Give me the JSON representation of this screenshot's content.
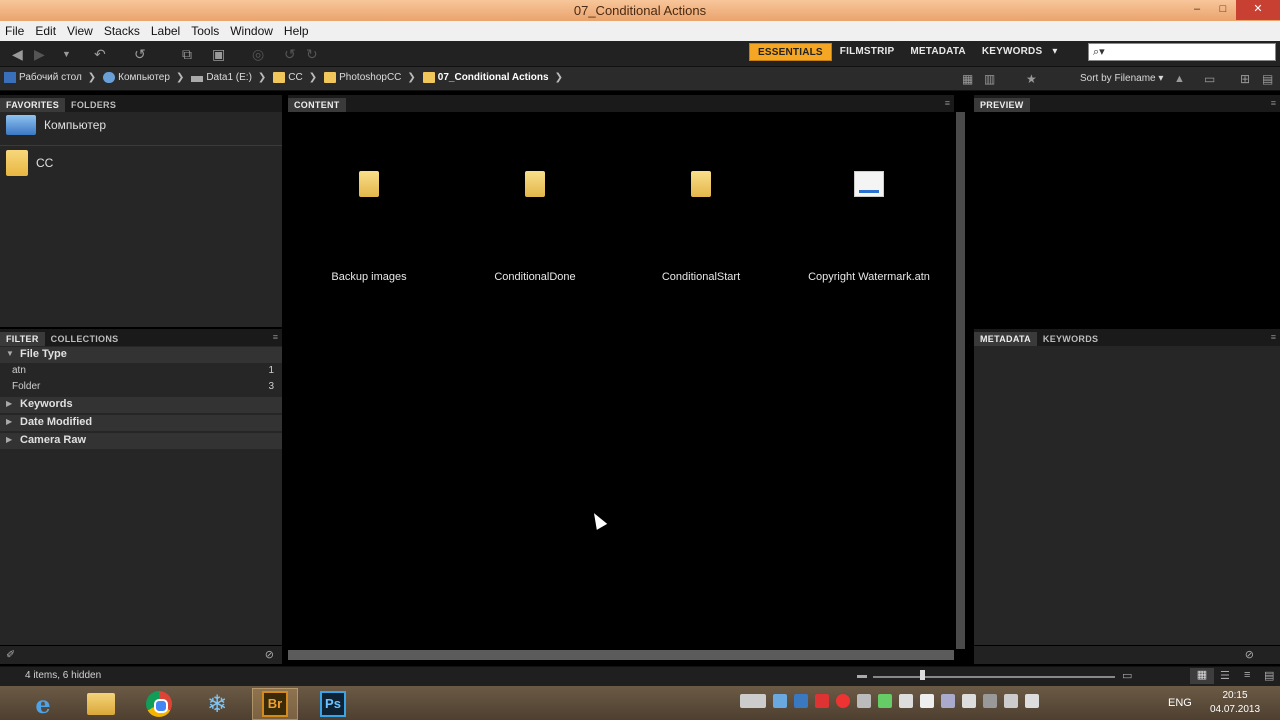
{
  "window": {
    "title": "07_Conditional Actions",
    "minimize": "–",
    "maximize": "□",
    "close": "✕"
  },
  "menu": [
    "File",
    "Edit",
    "View",
    "Stacks",
    "Label",
    "Tools",
    "Window",
    "Help"
  ],
  "workspaces": [
    "ESSENTIALS",
    "FILMSTRIP",
    "METADATA",
    "KEYWORDS"
  ],
  "workspace_active": "ESSENTIALS",
  "workspace_dropdown": "▾",
  "search": {
    "value": "",
    "placeholder": "⌕▾"
  },
  "breadcrumb": [
    {
      "label": "Рабочий стол",
      "icon": "desktop-icon"
    },
    {
      "label": "Компьютер",
      "icon": "computer-icon"
    },
    {
      "label": "Data1 (E:)",
      "icon": "drive-icon"
    },
    {
      "label": "CC",
      "icon": "folder-icon"
    },
    {
      "label": "PhotoshopCC",
      "icon": "folder-icon"
    },
    {
      "label": "07_Conditional Actions",
      "icon": "folder-icon"
    }
  ],
  "sort": {
    "label": "Sort by Filename ▾"
  },
  "left_top_panel": {
    "tabs": [
      "FAVORITES",
      "FOLDERS"
    ],
    "items": [
      {
        "label": "Компьютер",
        "icon": "computer-icon"
      },
      {
        "label": "CC",
        "icon": "folder-icon"
      }
    ]
  },
  "filter_panel": {
    "tabs": [
      "FILTER",
      "COLLECTIONS"
    ],
    "file_type": {
      "label": "File Type",
      "items": [
        {
          "label": "atn",
          "count": "1"
        },
        {
          "label": "Folder",
          "count": "3"
        }
      ]
    },
    "categories": [
      "Keywords",
      "Date Modified",
      "Camera Raw"
    ]
  },
  "content": {
    "tab": "CONTENT",
    "items": [
      {
        "name": "Backup images",
        "type": "folder"
      },
      {
        "name": "ConditionalDone",
        "type": "folder"
      },
      {
        "name": "ConditionalStart",
        "type": "folder"
      },
      {
        "name": "Copyright Watermark.atn",
        "type": "atn"
      }
    ]
  },
  "preview_panel": {
    "tab": "PREVIEW"
  },
  "metadata_panel": {
    "tabs": [
      "METADATA",
      "KEYWORDS"
    ]
  },
  "status": {
    "text": "4 items, 6 hidden"
  },
  "taskbar": {
    "apps": [
      "ie-icon",
      "explorer-icon",
      "chrome-icon",
      "snowflake-icon",
      "bridge-icon",
      "photoshop-icon"
    ],
    "bridge_label": "Br",
    "photoshop_label": "Ps",
    "ie_label": "e",
    "snow_label": "❄",
    "lang": "ENG",
    "time": "20:15",
    "date": "04.07.2013"
  },
  "colors": {
    "accent": "#f5a623",
    "titlebar": "#eaa36d",
    "panel": "#262626",
    "content": "#000000"
  }
}
